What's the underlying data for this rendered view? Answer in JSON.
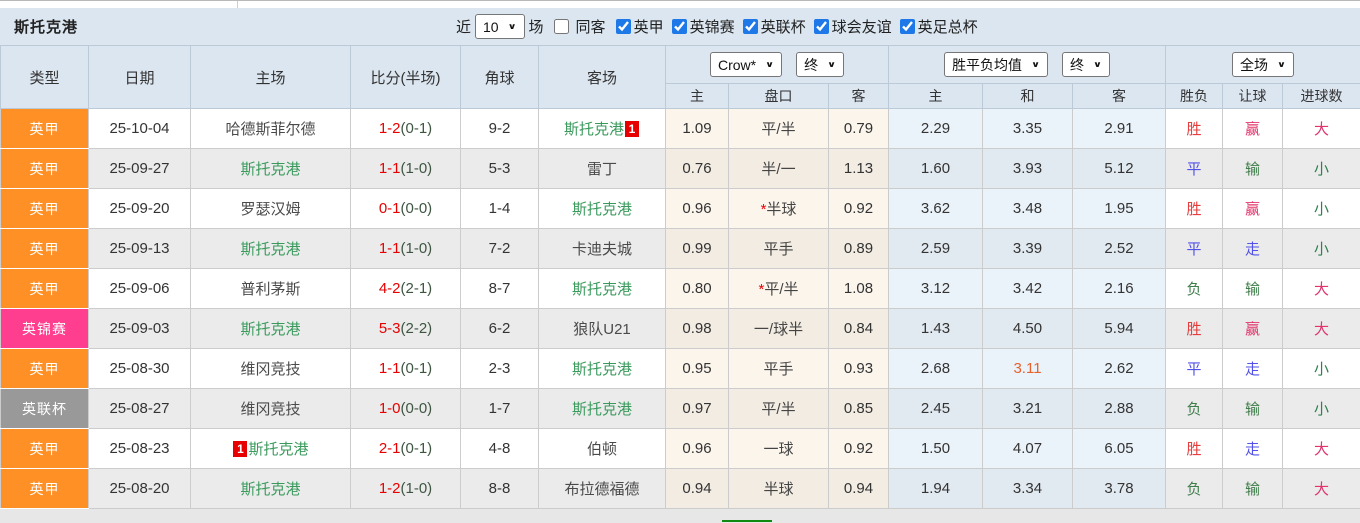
{
  "title": "斯托克港",
  "filter": {
    "near_label": "近",
    "count": "10",
    "games_label": "场",
    "same_away_label": "同客",
    "same_away_checked": false,
    "leagues": [
      {
        "label": "英甲",
        "checked": true
      },
      {
        "label": "英锦赛",
        "checked": true
      },
      {
        "label": "英联杯",
        "checked": true
      },
      {
        "label": "球会友谊",
        "checked": true
      },
      {
        "label": "英足总杯",
        "checked": true
      }
    ]
  },
  "selects": {
    "company": "Crow*",
    "company_state": "终",
    "avg": "胜平负均值",
    "avg_state": "终",
    "scope": "全场"
  },
  "columns": {
    "left": [
      "类型",
      "日期",
      "主场",
      "比分(半场)",
      "角球",
      "客场"
    ],
    "sub": [
      "主",
      "盘口",
      "客",
      "主",
      "和",
      "客",
      "胜负",
      "让球",
      "进球数"
    ]
  },
  "rows": [
    {
      "league": "英甲",
      "league_color": "orange",
      "date": "25-10-04",
      "home": "哈德斯菲尔德",
      "home_focus": false,
      "home_badge_before": "",
      "home_badge_after": "",
      "score": "1-2",
      "half": "(0-1)",
      "corners": "9-2",
      "away": "斯托克港",
      "away_focus": true,
      "away_badge_before": "",
      "away_badge_after": "1",
      "o_home": "1.09",
      "o_star": false,
      "o_line": "平/半",
      "o_away": "0.79",
      "a_home": "2.29",
      "a_draw": "3.35",
      "a_draw_hot": false,
      "a_away": "2.91",
      "res": "胜",
      "res_c": "win",
      "han": "赢",
      "han_c": "cover",
      "goal": "大",
      "goal_c": "big"
    },
    {
      "league": "英甲",
      "league_color": "orange",
      "date": "25-09-27",
      "home": "斯托克港",
      "home_focus": true,
      "home_badge_before": "",
      "home_badge_after": "",
      "score": "1-1",
      "half": "(1-0)",
      "corners": "5-3",
      "away": "雷丁",
      "away_focus": false,
      "away_badge_before": "",
      "away_badge_after": "",
      "o_home": "0.76",
      "o_star": false,
      "o_line": "半/一",
      "o_away": "1.13",
      "a_home": "1.60",
      "a_draw": "3.93",
      "a_draw_hot": false,
      "a_away": "5.12",
      "res": "平",
      "res_c": "draw",
      "han": "输",
      "han_c": "lost",
      "goal": "小",
      "goal_c": "small"
    },
    {
      "league": "英甲",
      "league_color": "orange",
      "date": "25-09-20",
      "home": "罗瑟汉姆",
      "home_focus": false,
      "home_badge_before": "",
      "home_badge_after": "",
      "score": "0-1",
      "half": "(0-0)",
      "corners": "1-4",
      "away": "斯托克港",
      "away_focus": true,
      "away_badge_before": "",
      "away_badge_after": "",
      "o_home": "0.96",
      "o_star": true,
      "o_line": "半球",
      "o_away": "0.92",
      "a_home": "3.62",
      "a_draw": "3.48",
      "a_draw_hot": false,
      "a_away": "1.95",
      "res": "胜",
      "res_c": "win",
      "han": "赢",
      "han_c": "cover",
      "goal": "小",
      "goal_c": "small"
    },
    {
      "league": "英甲",
      "league_color": "orange",
      "date": "25-09-13",
      "home": "斯托克港",
      "home_focus": true,
      "home_badge_before": "",
      "home_badge_after": "",
      "score": "1-1",
      "half": "(1-0)",
      "corners": "7-2",
      "away": "卡迪夫城",
      "away_focus": false,
      "away_badge_before": "",
      "away_badge_after": "",
      "o_home": "0.99",
      "o_star": false,
      "o_line": "平手",
      "o_away": "0.89",
      "a_home": "2.59",
      "a_draw": "3.39",
      "a_draw_hot": false,
      "a_away": "2.52",
      "res": "平",
      "res_c": "draw",
      "han": "走",
      "han_c": "void",
      "goal": "小",
      "goal_c": "small"
    },
    {
      "league": "英甲",
      "league_color": "orange",
      "date": "25-09-06",
      "home": "普利茅斯",
      "home_focus": false,
      "home_badge_before": "",
      "home_badge_after": "",
      "score": "4-2",
      "half": "(2-1)",
      "corners": "8-7",
      "away": "斯托克港",
      "away_focus": true,
      "away_badge_before": "",
      "away_badge_after": "",
      "o_home": "0.80",
      "o_star": true,
      "o_line": "平/半",
      "o_away": "1.08",
      "a_home": "3.12",
      "a_draw": "3.42",
      "a_draw_hot": false,
      "a_away": "2.16",
      "res": "负",
      "res_c": "lose",
      "han": "输",
      "han_c": "lost",
      "goal": "大",
      "goal_c": "big"
    },
    {
      "league": "英锦赛",
      "league_color": "pink",
      "date": "25-09-03",
      "home": "斯托克港",
      "home_focus": true,
      "home_badge_before": "",
      "home_badge_after": "",
      "score": "5-3",
      "half": "(2-2)",
      "corners": "6-2",
      "away": "狼队U21",
      "away_focus": false,
      "away_badge_before": "",
      "away_badge_after": "",
      "o_home": "0.98",
      "o_star": false,
      "o_line": "一/球半",
      "o_away": "0.84",
      "a_home": "1.43",
      "a_draw": "4.50",
      "a_draw_hot": false,
      "a_away": "5.94",
      "res": "胜",
      "res_c": "win",
      "han": "赢",
      "han_c": "cover",
      "goal": "大",
      "goal_c": "big"
    },
    {
      "league": "英甲",
      "league_color": "orange",
      "date": "25-08-30",
      "home": "维冈竞技",
      "home_focus": false,
      "home_badge_before": "",
      "home_badge_after": "",
      "score": "1-1",
      "half": "(0-1)",
      "corners": "2-3",
      "away": "斯托克港",
      "away_focus": true,
      "away_badge_before": "",
      "away_badge_after": "",
      "o_home": "0.95",
      "o_star": false,
      "o_line": "平手",
      "o_away": "0.93",
      "a_home": "2.68",
      "a_draw": "3.11",
      "a_draw_hot": true,
      "a_away": "2.62",
      "res": "平",
      "res_c": "draw",
      "han": "走",
      "han_c": "void",
      "goal": "小",
      "goal_c": "small"
    },
    {
      "league": "英联杯",
      "league_color": "gray",
      "date": "25-08-27",
      "home": "维冈竞技",
      "home_focus": false,
      "home_badge_before": "",
      "home_badge_after": "",
      "score": "1-0",
      "half": "(0-0)",
      "corners": "1-7",
      "away": "斯托克港",
      "away_focus": true,
      "away_badge_before": "",
      "away_badge_after": "",
      "o_home": "0.97",
      "o_star": false,
      "o_line": "平/半",
      "o_away": "0.85",
      "a_home": "2.45",
      "a_draw": "3.21",
      "a_draw_hot": false,
      "a_away": "2.88",
      "res": "负",
      "res_c": "lose",
      "han": "输",
      "han_c": "lost",
      "goal": "小",
      "goal_c": "small"
    },
    {
      "league": "英甲",
      "league_color": "orange",
      "date": "25-08-23",
      "home": "斯托克港",
      "home_focus": true,
      "home_badge_before": "1",
      "home_badge_after": "",
      "score": "2-1",
      "half": "(0-1)",
      "corners": "4-8",
      "away": "伯顿",
      "away_focus": false,
      "away_badge_before": "",
      "away_badge_after": "",
      "o_home": "0.96",
      "o_star": false,
      "o_line": "一球",
      "o_away": "0.92",
      "a_home": "1.50",
      "a_draw": "4.07",
      "a_draw_hot": false,
      "a_away": "6.05",
      "res": "胜",
      "res_c": "win",
      "han": "走",
      "han_c": "void",
      "goal": "大",
      "goal_c": "big"
    },
    {
      "league": "英甲",
      "league_color": "orange",
      "date": "25-08-20",
      "home": "斯托克港",
      "home_focus": true,
      "home_badge_before": "",
      "home_badge_after": "",
      "score": "1-2",
      "half": "(1-0)",
      "corners": "8-8",
      "away": "布拉德福德",
      "away_focus": false,
      "away_badge_before": "",
      "away_badge_after": "",
      "o_home": "0.94",
      "o_star": false,
      "o_line": "半球",
      "o_away": "0.94",
      "a_home": "1.94",
      "a_draw": "3.34",
      "a_draw_hot": false,
      "a_away": "3.78",
      "res": "负",
      "res_c": "lose",
      "han": "输",
      "han_c": "lost",
      "goal": "大",
      "goal_c": "big"
    }
  ],
  "colors": {
    "league_orange": "#FF9025",
    "league_pink": "#FF3E8F",
    "league_gray": "#999999",
    "checkbox_accent": "#1E78E8",
    "score_red": "#E60000",
    "half_score": "#3E5641",
    "focus_team_green": "#3A9A5C",
    "win_red": "#E63C3C",
    "draw_blue": "#5252E8",
    "lose_green": "#3F7D4A",
    "cover_crimson": "#E0346A",
    "small_green": "#2F8050",
    "hot_value": "#E8602C",
    "header_bg": "#DCE6F0",
    "alt_row_bg": "#EBEBEB",
    "odds_col_bg": "#FBF5EC",
    "avg_col_bg": "#EBF3FA"
  }
}
